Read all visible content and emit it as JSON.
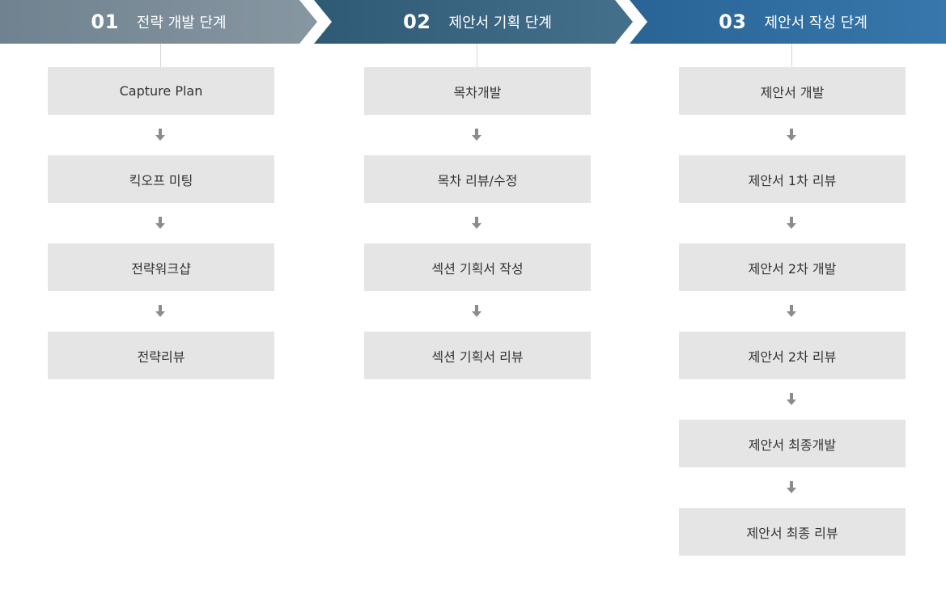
{
  "colors": {
    "phase1": "#7b8d99",
    "phase2": "#3f6a85",
    "phase3": "#2e6ea1",
    "box": "#e5e5e5",
    "box_text": "#333333",
    "arrow": "#8c8c8c",
    "connector": "#d6d6d6"
  },
  "phases": [
    {
      "number": "01",
      "title": "전략 개발 단계",
      "steps": [
        "Capture Plan",
        "킥오프 미팅",
        "전략워크샵",
        "전략리뷰"
      ]
    },
    {
      "number": "02",
      "title": "제안서 기획 단계",
      "steps": [
        "목차개발",
        "목차 리뷰/수정",
        "섹션 기획서 작성",
        "섹션 기획서 리뷰"
      ]
    },
    {
      "number": "03",
      "title": "제안서 작성 단계",
      "steps": [
        "제안서 개발",
        "제안서 1차 리뷰",
        "제안서 2차 개발",
        "제안서 2차 리뷰",
        "제안서 최종개발",
        "제안서 최종 리뷰"
      ]
    }
  ]
}
